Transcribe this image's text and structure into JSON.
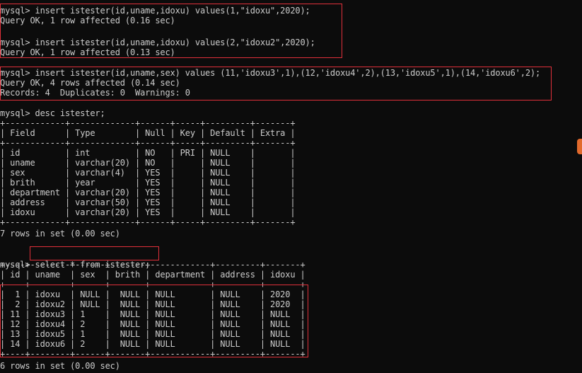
{
  "terminal": {
    "block1": [
      "mysql> insert istester(id,uname,idoxu) values(1,\"idoxu\",2020);",
      "Query OK, 1 row affected (0.16 sec)"
    ],
    "block2": [
      "mysql> insert istester(id,uname,idoxu) values(2,\"idoxu2\",2020);",
      "Query OK, 1 row affected (0.13 sec)"
    ],
    "block3": [
      "mysql> insert istester(id,uname,sex) values (11,'idoxu3',1),(12,'idoxu4',2),(13,'idoxu5',1),(14,'idoxu6',2);",
      "Query OK, 4 rows affected (0.14 sec)",
      "Records: 4  Duplicates: 0  Warnings: 0"
    ],
    "desc_command": "mysql> desc istester;",
    "desc_table": [
      "+------------+-------------+------+-----+---------+-------+",
      "| Field      | Type        | Null | Key | Default | Extra |",
      "+------------+-------------+------+-----+---------+-------+",
      "| id         | int         | NO   | PRI | NULL    |       |",
      "| uname      | varchar(20) | NO   |     | NULL    |       |",
      "| sex        | varchar(4)  | YES  |     | NULL    |       |",
      "| brith      | year        | YES  |     | NULL    |       |",
      "| department | varchar(20) | YES  |     | NULL    |       |",
      "| address    | varchar(50) | YES  |     | NULL    |       |",
      "| idoxu      | varchar(20) | YES  |     | NULL    |       |",
      "+------------+-------------+------+-----+---------+-------+"
    ],
    "desc_summary": "7 rows in set (0.00 sec)",
    "select_prompt": "mysql>",
    "select_query": " select * from istester;",
    "select_table": [
      "+----+--------+------+-------+------------+---------+-------+",
      "| id | uname  | sex  | brith | department | address | idoxu |",
      "+----+--------+------+-------+------------+---------+-------+",
      "|  1 | idoxu  | NULL |  NULL | NULL       | NULL    | 2020  |",
      "|  2 | idoxu2 | NULL |  NULL | NULL       | NULL    | 2020  |",
      "| 11 | idoxu3 | 1    |  NULL | NULL       | NULL    | NULL  |",
      "| 12 | idoxu4 | 2    |  NULL | NULL       | NULL    | NULL  |",
      "| 13 | idoxu5 | 1    |  NULL | NULL       | NULL    | NULL  |",
      "| 14 | idoxu6 | 2    |  NULL | NULL       | NULL    | NULL  |",
      "+----+--------+------+-------+------------+---------+-------+"
    ],
    "select_summary": "6 rows in set (0.00 sec)"
  },
  "colors": {
    "background": "#0c0c0c",
    "text": "#cccccc",
    "highlight_box": "#e0303a"
  }
}
